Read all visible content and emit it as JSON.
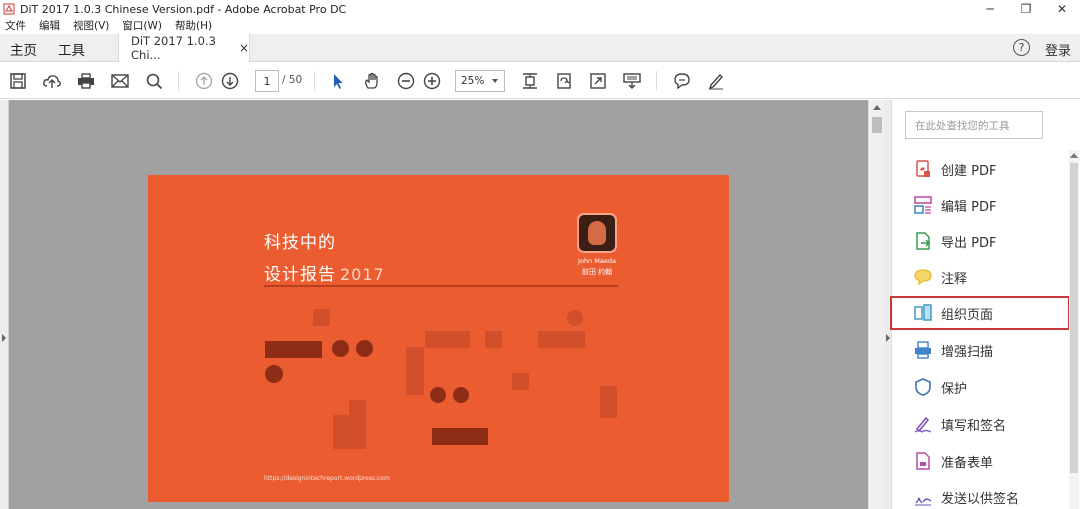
{
  "window": {
    "title": "DiT 2017 1.0.3 Chinese Version.pdf - Adobe Acrobat Pro DC",
    "minimize": "─",
    "restore": "❐",
    "close": "✕"
  },
  "menu": [
    "文件",
    "编辑",
    "视图(V)",
    "窗口(W)",
    "帮助(H)"
  ],
  "tabs": {
    "home": "主页",
    "tools": "工具",
    "document": "DiT 2017 1.0.3 Chi...",
    "close": "×",
    "help": "?",
    "login": "登录"
  },
  "toolbar": {
    "page_current": "1",
    "page_total": "/ 50",
    "zoom": "25%",
    "icons": [
      "save-icon",
      "upload-icon",
      "print-icon",
      "mail-icon",
      "search-icon",
      "prev-page-icon",
      "next-page-icon",
      "select-arrow-icon",
      "hand-icon",
      "zoom-out-icon",
      "zoom-in-icon",
      "fit-page-icon",
      "rotate-icon",
      "fullscreen-icon",
      "read-mode-icon",
      "comment-icon",
      "sign-icon"
    ]
  },
  "document": {
    "title_line1": "科技中的",
    "title_line2": "设计报告",
    "title_year": "2017",
    "author_en": "John Maeda",
    "author_cn": "前田 约翰",
    "url": "https://designintechreport.wordpress.com"
  },
  "tools_pane": {
    "search_placeholder": "在此处查找您的工具",
    "items": [
      {
        "label": "创建 PDF",
        "icon": "create-pdf-icon",
        "color": "#d9534f"
      },
      {
        "label": "编辑 PDF",
        "icon": "edit-pdf-icon",
        "color": "#c0439a"
      },
      {
        "label": "导出 PDF",
        "icon": "export-pdf-icon",
        "color": "#3a9a4f"
      },
      {
        "label": "注释",
        "icon": "comment-icon",
        "color": "#e8b92a"
      },
      {
        "label": "组织页面",
        "icon": "organize-pages-icon",
        "color": "#3f9ac9",
        "selected": true
      },
      {
        "label": "增强扫描",
        "icon": "enhance-scan-icon",
        "color": "#3f84c9"
      },
      {
        "label": "保护",
        "icon": "protect-icon",
        "color": "#3f6fb9"
      },
      {
        "label": "填写和签名",
        "icon": "fill-sign-icon",
        "color": "#7a4fb5"
      },
      {
        "label": "准备表单",
        "icon": "prepare-form-icon",
        "color": "#b54fa0"
      },
      {
        "label": "发送以供签名",
        "icon": "send-sign-icon",
        "color": "#6b4fb5"
      }
    ]
  }
}
